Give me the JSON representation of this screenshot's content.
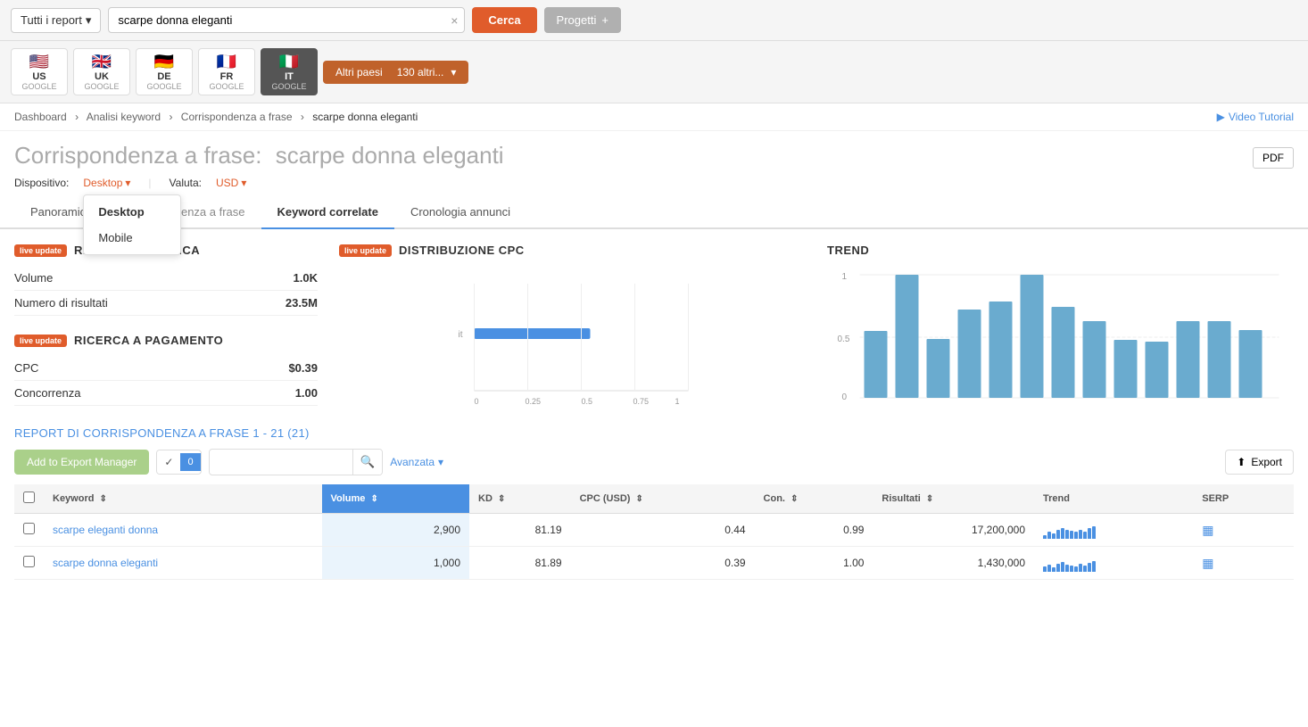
{
  "topBar": {
    "reportSelectLabel": "Tutti i report",
    "searchValue": "scarpe donna eleganti",
    "clearBtn": "×",
    "cercaBtn": "Cerca",
    "progettiBtn": "Progetti",
    "addBtn": "+"
  },
  "countryBar": {
    "countries": [
      {
        "code": "US",
        "flag": "🇺🇸",
        "engine": "GOOGLE"
      },
      {
        "code": "UK",
        "flag": "🇬🇧",
        "engine": "GOOGLE"
      },
      {
        "code": "DE",
        "flag": "🇩🇪",
        "engine": "GOOGLE"
      },
      {
        "code": "FR",
        "flag": "🇫🇷",
        "engine": "GOOGLE"
      },
      {
        "code": "IT",
        "flag": "🇮🇹",
        "engine": "GOOGLE"
      }
    ],
    "altriPaesi": "Altri paesi",
    "altriCount": "130 altri...",
    "activeIndex": 4
  },
  "breadcrumb": {
    "items": [
      "Dashboard",
      "Analisi keyword",
      "Corrispondenza a frase",
      "scarpe donna eleganti"
    ],
    "videoTutorial": "Video Tutorial"
  },
  "pageHeader": {
    "prefix": "Corrispondenza a frase:",
    "keyword": "scarpe donna eleganti",
    "pdfBtn": "PDF"
  },
  "deviceRow": {
    "deviceLabel": "Dispositivo:",
    "deviceValue": "Desktop",
    "valutaLabel": "Valuta:",
    "valutaValue": "USD"
  },
  "deviceDropdown": {
    "items": [
      "Desktop",
      "Mobile"
    ],
    "selectedIndex": 0
  },
  "tabs": [
    {
      "label": "Panoramica",
      "active": false
    },
    {
      "label": "Corrispondenza a frase",
      "active": true
    },
    {
      "label": "Keyword correlate",
      "active": false
    },
    {
      "label": "Cronologia annunci",
      "active": false
    }
  ],
  "ricercaOrganica": {
    "title": "RICERCA ORGANICA",
    "rows": [
      {
        "label": "Volume",
        "value": "1.0K"
      },
      {
        "label": "Numero di risultati",
        "value": "23.5M"
      }
    ]
  },
  "ricercaPagamento": {
    "title": "RICERCA A PAGAMENTO",
    "rows": [
      {
        "label": "CPC",
        "value": "$0.39"
      },
      {
        "label": "Concorrenza",
        "value": "1.00"
      }
    ]
  },
  "cpcChart": {
    "title": "DISTRIBUZIONE CPC",
    "axisLabels": [
      "0",
      "0.25",
      "0.5",
      "0.75",
      "1"
    ],
    "barLabel": "it",
    "barValue": 0.5
  },
  "trendChart": {
    "title": "TREND",
    "yLabels": [
      "1",
      "0.5",
      "0"
    ],
    "bars": [
      0.55,
      1.0,
      0.48,
      0.72,
      0.78,
      1.0,
      0.74,
      0.62,
      0.47,
      0.46,
      0.62,
      0.62,
      0.55
    ]
  },
  "reportSection": {
    "title": "REPORT DI CORRISPONDENZA A FRASE",
    "rangeLabel": "1 - 21 (21)",
    "addExportBtn": "Add to Export Manager",
    "avanzataBtn": "Avanzata",
    "exportBtn": "Export",
    "checkBadgeNum": "0"
  },
  "tableHeaders": [
    {
      "label": "Keyword",
      "sortable": true,
      "active": false
    },
    {
      "label": "Volume",
      "sortable": true,
      "active": true
    },
    {
      "label": "KD",
      "sortable": true,
      "active": false
    },
    {
      "label": "CPC (USD)",
      "sortable": true,
      "active": false
    },
    {
      "label": "Con.",
      "sortable": true,
      "active": false
    },
    {
      "label": "Risultati",
      "sortable": true,
      "active": false
    },
    {
      "label": "Trend",
      "sortable": false,
      "active": false
    },
    {
      "label": "SERP",
      "sortable": false,
      "active": false
    }
  ],
  "tableRows": [
    {
      "keyword": "scarpe eleganti donna",
      "volume": "2,900",
      "kd": "81.19",
      "cpc": "0.44",
      "con": "0.99",
      "risultati": "17,200,000",
      "trendBars": [
        4,
        8,
        6,
        10,
        12,
        10,
        9,
        8,
        10,
        8,
        12,
        14
      ],
      "serp": "▦"
    },
    {
      "keyword": "scarpe donna eleganti",
      "volume": "1,000",
      "kd": "81.89",
      "cpc": "0.39",
      "con": "1.00",
      "risultati": "1,430,000",
      "trendBars": [
        6,
        8,
        5,
        9,
        11,
        8,
        7,
        6,
        9,
        7,
        10,
        12
      ],
      "serp": "▦"
    }
  ]
}
